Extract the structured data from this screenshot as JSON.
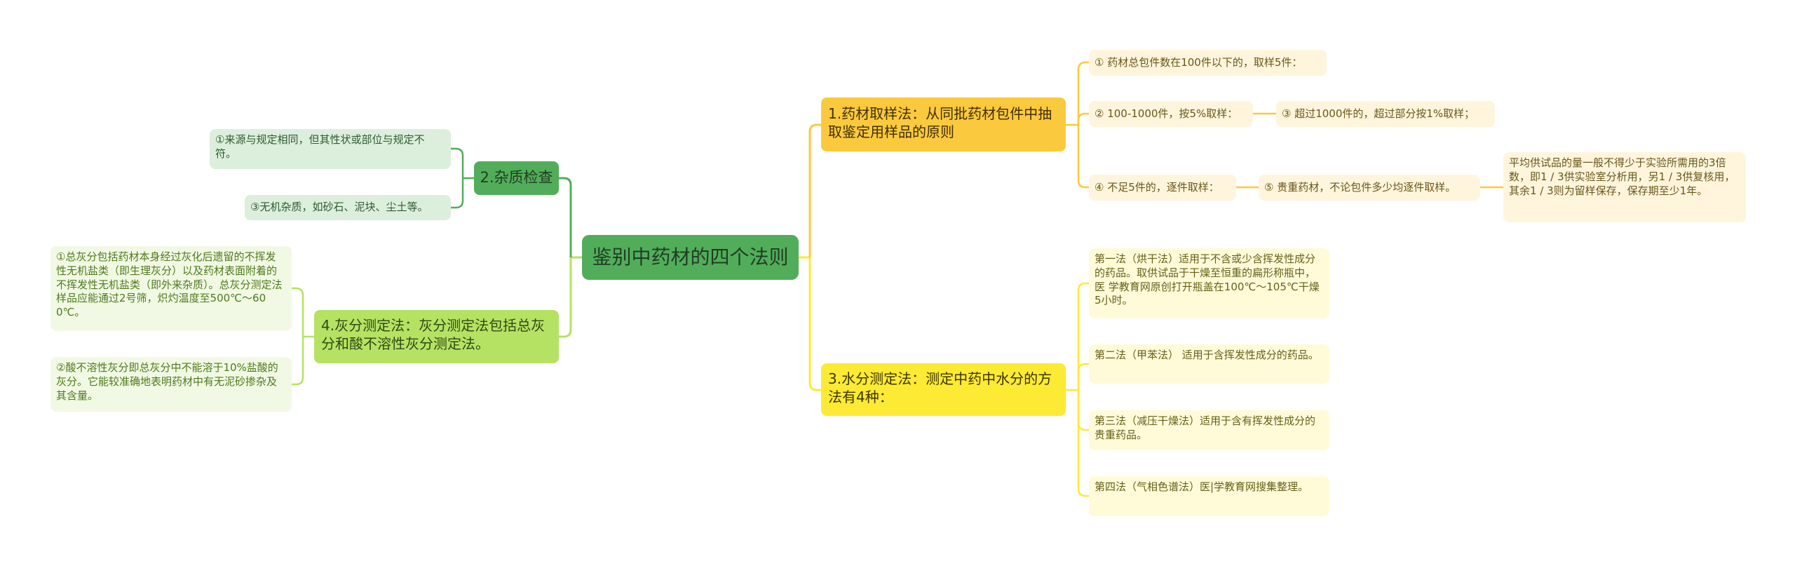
{
  "root": {
    "label": "鉴别中药材的四个法则"
  },
  "colors": {
    "root": "#52ad5a",
    "branch_impurity": "#52ad5a",
    "branch_ash": "#b6e264",
    "branch_sampling": "#fbc93e",
    "branch_water": "#fdea34"
  },
  "branches": {
    "sampling": {
      "label": "1.药材取样法：从同批药材包件中抽取鉴定用样品的原则",
      "items": [
        "① 药材总包件数在100件以下的，取样5件：",
        "② 100-1000件，按5%取样：",
        "③ 超过1000件的，超过部分按1%取样；",
        "④ 不足5件的，逐件取样：",
        "⑤ 贵重药材，不论包件多少均逐件取样。",
        "平均供试品的量一般不得少于实验所需用的3倍数，即1 / 3供实验室分析用，另1 / 3供复核用，其余1 / 3则为留样保存，保存期至少1年。"
      ]
    },
    "impurity": {
      "label": "2.杂质检查",
      "items": [
        "①来源与规定相同，但其性状或部位与规定不符。",
        "③无机杂质，如砂石、泥块、尘土等。"
      ]
    },
    "water": {
      "label": "3.水分测定法：测定中药中水分的方法有4种：",
      "items": [
        "第一法（烘干法）适用于不含或少含挥发性成分的药品。取供试品于干燥至恒重的扁形称瓶中，医 学教育网原创打开瓶盖在100℃～105℃干燥5小时。",
        "第二法（甲苯法） 适用于含挥发性成分的药品。",
        "第三法（减压干燥法）适用于含有挥发性成分的贵重药品。",
        "第四法（气相色谱法）医|学教育网搜集整理。"
      ]
    },
    "ash": {
      "label": "4.灰分测定法：灰分测定法包括总灰分和酸不溶性灰分测定法。",
      "items": [
        "①总灰分包括药材本身经过灰化后遗留的不挥发性无机盐类（即生理灰分）以及药材表面附着的不挥发性无机盐类（即外来杂质）。总灰分测定法样品应能通过2号筛，炽灼温度至500℃～600℃。",
        "②酸不溶性灰分即总灰分中不能溶于10%盐酸的灰分。它能较准确地表明药材中有无泥砂掺杂及其含量。"
      ]
    }
  }
}
